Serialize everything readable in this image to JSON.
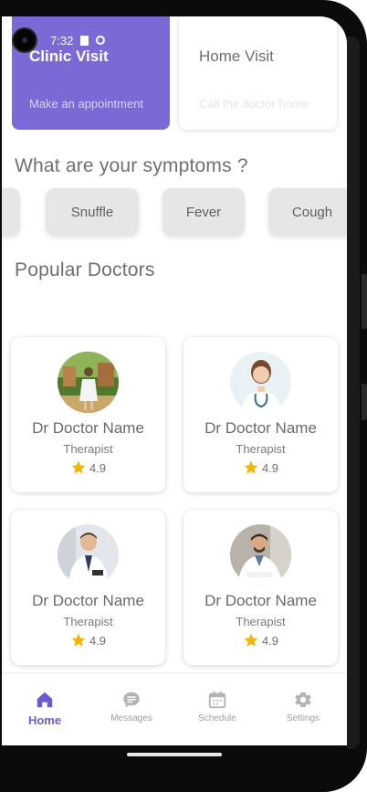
{
  "status_bar": {
    "time": "7:32"
  },
  "visit_cards": [
    {
      "title": "Clinic Visit",
      "subtitle": "Make an appointment"
    },
    {
      "title": "Home Visit",
      "subtitle": "Call the doctor home"
    }
  ],
  "symptoms": {
    "heading": "What are your symptoms ?",
    "chips": [
      "Snuffle",
      "Fever",
      "Cough"
    ]
  },
  "popular": {
    "heading": "Popular Doctors",
    "doctors": [
      {
        "name": "Dr Doctor Name",
        "role": "Therapist",
        "rating": "4.9"
      },
      {
        "name": "Dr Doctor Name",
        "role": "Therapist",
        "rating": "4.9"
      },
      {
        "name": "Dr Doctor Name",
        "role": "Therapist",
        "rating": "4.9"
      },
      {
        "name": "Dr Doctor Name",
        "role": "Therapist",
        "rating": "4.9"
      }
    ]
  },
  "nav": {
    "items": [
      {
        "label": "Home",
        "icon": "home-icon",
        "active": true
      },
      {
        "label": "Messages",
        "icon": "chat-icon",
        "active": false
      },
      {
        "label": "Schedule",
        "icon": "calendar-icon",
        "active": false
      },
      {
        "label": "Settings",
        "icon": "gear-icon",
        "active": false
      }
    ]
  },
  "colors": {
    "accent": "#7b6ad6",
    "star": "#f5b400",
    "chip": "#e6e6e6",
    "text_muted": "#6f6f6f"
  }
}
